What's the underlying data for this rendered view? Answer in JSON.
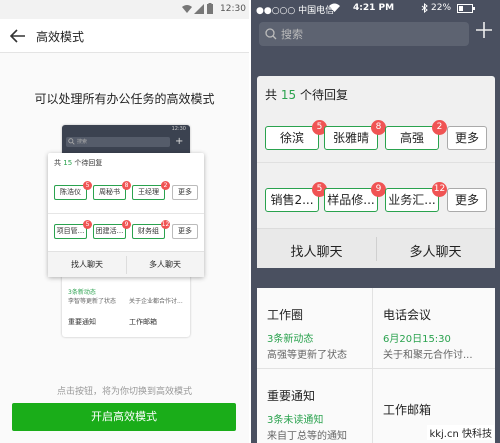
{
  "left": {
    "status": {
      "time": "12:30"
    },
    "title": "高效模式",
    "headline": "可以处理所有办公任务的高效模式",
    "mini": {
      "time": "12:30",
      "search_placeholder": "搜索",
      "card": {
        "pending_prefix": "共",
        "pending_count": "15",
        "pending_suffix": "个待回复",
        "row1": [
          {
            "label": "陈浩仪",
            "badge": "5"
          },
          {
            "label": "周秘书",
            "badge": "8"
          },
          {
            "label": "王经理",
            "badge": "2"
          }
        ],
        "row2": [
          {
            "label": "项目管...",
            "badge": "5"
          },
          {
            "label": "团建活...",
            "badge": "9"
          },
          {
            "label": "财务组",
            "badge": "12"
          }
        ],
        "more": "更多",
        "find_chat": "找人聊天",
        "group_chat": "多人聊天"
      },
      "bg_tiles": {
        "t1_sub": "3条新动态",
        "t1_desc": "李智等更新了状态",
        "t2_desc": "关于企业都合作讨...",
        "t3_title": "重要通知",
        "t4_title": "工作邮箱"
      }
    },
    "hint": "点击按钮，将为你切换到高效模式",
    "button": "开启高效模式"
  },
  "right": {
    "status": {
      "carrier": "●●○○○ 中国电信",
      "time": "4:21 PM",
      "battery": "22%"
    },
    "search_placeholder": "搜索",
    "card": {
      "pending_prefix": "共",
      "pending_count": "15",
      "pending_suffix": "个待回复",
      "row1": [
        {
          "label": "徐滨",
          "badge": "5"
        },
        {
          "label": "张雅晴",
          "badge": "8"
        },
        {
          "label": "高强",
          "badge": "2"
        }
      ],
      "row2": [
        {
          "label": "销售2...",
          "badge": "5"
        },
        {
          "label": "样品修...",
          "badge": "9"
        },
        {
          "label": "业务汇...",
          "badge": "12"
        }
      ],
      "more": "更多",
      "find_chat": "找人聊天",
      "group_chat": "多人聊天"
    },
    "tiles": [
      {
        "title": "工作圈",
        "sub": "3条新动态",
        "desc": "高强等更新了状态"
      },
      {
        "title": "电话会议",
        "sub": "6月20日15:30",
        "desc": "关于和聚元合作讨..."
      },
      {
        "title": "重要通知",
        "sub": "3条未读通知",
        "desc": "来自丁总等的通知"
      },
      {
        "title": "工作邮箱",
        "sub": "",
        "desc": ""
      }
    ]
  },
  "watermark": "kkj.cn 快科技",
  "colors": {
    "accent": "#1aad19",
    "badge": "#f05454",
    "dark_bg": "#4a5060"
  }
}
